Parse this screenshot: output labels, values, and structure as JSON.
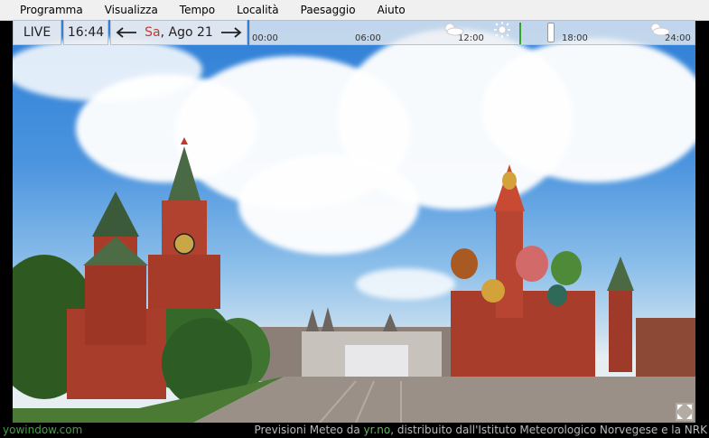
{
  "menu": [
    "Programma",
    "Visualizza",
    "Tempo",
    "Località",
    "Paesaggio",
    "Aiuto"
  ],
  "timebar": {
    "live_label": "LIVE",
    "time": "16:44",
    "day": "Sa",
    "date": ", Ago 21",
    "prev_icon": "arrow-left-icon",
    "next_icon": "arrow-right-icon",
    "ticks": [
      "00:00",
      "06:00",
      "12:00",
      "18:00",
      "24:00"
    ]
  },
  "footer": {
    "brand": "yowindow.com",
    "credit_pre": "Previsioni Meteo da ",
    "credit_link": "yr.no",
    "credit_post": ", distribuito dall'Istituto Meteorologico Norvegese e la NRK"
  },
  "colors": {
    "accent_date": "#c03c2a",
    "now_marker": "#37a32b",
    "brand": "#3fa33f"
  }
}
